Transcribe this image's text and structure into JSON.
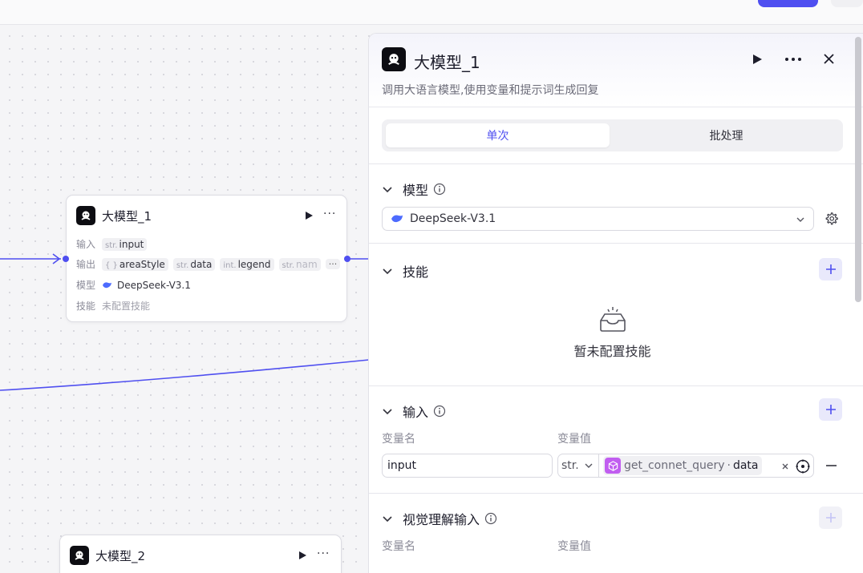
{
  "colors": {
    "accent": "#4f4ff0",
    "edge": "#4f4ff0",
    "cube": "#c15ef0"
  },
  "nodes": [
    {
      "title": "大模型_1",
      "input_label": "输入",
      "input_tags": [
        {
          "type": "str.",
          "name": "input"
        }
      ],
      "output_label": "输出",
      "output_tags": [
        {
          "type": "{ }",
          "name": "areaStyle"
        },
        {
          "type": "str.",
          "name": "data"
        },
        {
          "type": "int.",
          "name": "legend"
        },
        {
          "type": "str.",
          "name": "nam"
        }
      ],
      "output_more": "···",
      "model_label": "模型",
      "model_value": "DeepSeek-V3.1",
      "skill_label": "技能",
      "skill_value": "未配置技能"
    },
    {
      "title": "大模型_2"
    }
  ],
  "panel": {
    "title": "大模型_1",
    "description": "调用大语言模型,使用变量和提示词生成回复",
    "tabs": [
      "单次",
      "批处理"
    ],
    "model_section": {
      "title": "模型",
      "selected_model": "DeepSeek-V3.1"
    },
    "skill_section": {
      "title": "技能",
      "empty_text": "暂未配置技能"
    },
    "input_section": {
      "title": "输入",
      "col_name": "变量名",
      "col_value": "变量值",
      "rows": [
        {
          "name": "input",
          "type": "str.",
          "ref_source": "get_connet_query",
          "ref_sep": "·",
          "ref_field": "data"
        }
      ]
    },
    "vision_section": {
      "title": "视觉理解输入",
      "col_name": "变量名",
      "col_value": "变量值"
    }
  }
}
